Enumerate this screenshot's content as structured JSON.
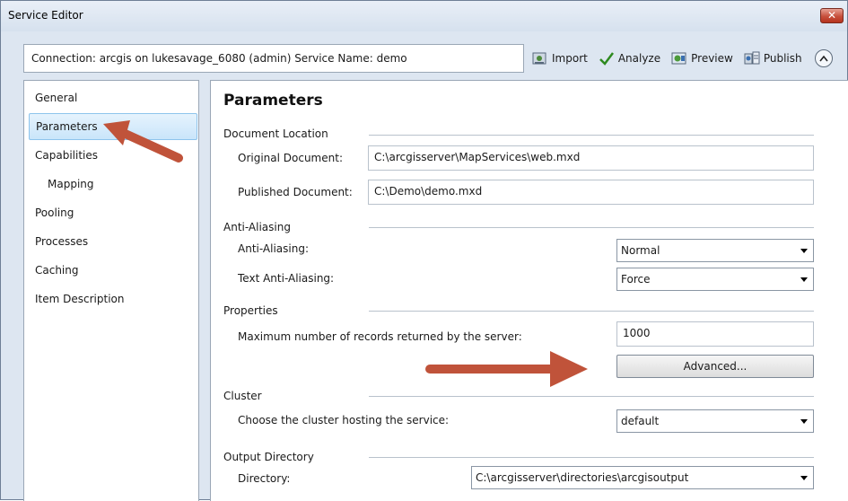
{
  "window": {
    "title": "Service Editor",
    "close_label": "✕"
  },
  "connection_text": "Connection: arcgis on lukesavage_6080 (admin)   Service Name: demo",
  "toolbar": {
    "import_label": "Import",
    "analyze_label": "Analyze",
    "preview_label": "Preview",
    "publish_label": "Publish",
    "collapse_symbol": "^"
  },
  "sidebar": {
    "items": [
      {
        "label": "General"
      },
      {
        "label": "Parameters",
        "selected": true
      },
      {
        "label": "Capabilities"
      },
      {
        "label": "Mapping",
        "indent": true
      },
      {
        "label": "Pooling"
      },
      {
        "label": "Processes"
      },
      {
        "label": "Caching"
      },
      {
        "label": "Item Description"
      }
    ]
  },
  "main": {
    "heading": "Parameters",
    "document_location": {
      "group": "Document Location",
      "original_label": "Original Document:",
      "original_value": "C:\\arcgisserver\\MapServices\\web.mxd",
      "published_label": "Published Document:",
      "published_value": "C:\\Demo\\demo.mxd"
    },
    "anti_aliasing": {
      "group": "Anti-Aliasing",
      "aa_label": "Anti-Aliasing:",
      "aa_value": "Normal",
      "text_aa_label": "Text Anti-Aliasing:",
      "text_aa_value": "Force"
    },
    "properties": {
      "group": "Properties",
      "max_records_label": "Maximum number of records returned by the server:",
      "max_records_value": "1000",
      "advanced_label": "Advanced..."
    },
    "cluster": {
      "group": "Cluster",
      "label": "Choose the cluster hosting the service:",
      "value": "default"
    },
    "output_directory": {
      "group": "Output Directory",
      "label": "Directory:",
      "value": "C:\\arcgisserver\\directories\\arcgisoutput"
    }
  },
  "colors": {
    "annotation_arrow": "#c0533a",
    "selection": "#c9e5fa",
    "frame": "#dde6f1"
  }
}
